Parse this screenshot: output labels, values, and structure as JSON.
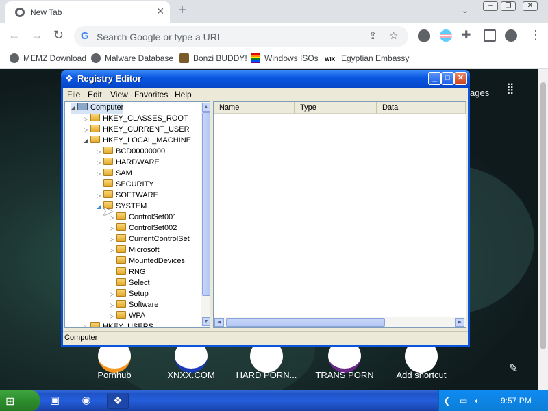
{
  "browser": {
    "tab_title": "New Tab",
    "omnibox_placeholder": "Search Google or type a URL",
    "bookmarks": [
      "MEMZ Download",
      "Malware Database",
      "Bonzi BUDDY!",
      "Windows ISOs",
      "Egyptian Embassy"
    ],
    "images_link": "ages",
    "shortcuts": [
      "Pornhub",
      "XNXX.COM",
      "HARD PORN...",
      "TRANS PORN",
      "Add shortcut"
    ],
    "icons": {
      "back": "back-arrow-icon",
      "forward": "forward-arrow-icon",
      "reload": "reload-icon",
      "share": "share-icon",
      "star": "bookmark-star-icon",
      "extensions": "puzzle-icon",
      "sidepanel": "side-panel-icon",
      "profile": "profile-icon",
      "menu": "kebab-menu-icon",
      "apps": "apps-grid-icon",
      "edit": "pencil-icon"
    }
  },
  "regedit": {
    "title": "Registry Editor",
    "menu": [
      "File",
      "Edit",
      "View",
      "Favorites",
      "Help"
    ],
    "tree": {
      "root": "Computer",
      "hives": [
        "HKEY_CLASSES_ROOT",
        "HKEY_CURRENT_USER",
        "HKEY_LOCAL_MACHINE"
      ],
      "hklm_children": [
        "BCD00000000",
        "HARDWARE",
        "SAM",
        "SECURITY",
        "SOFTWARE",
        "SYSTEM"
      ],
      "system_children": [
        "ControlSet001",
        "ControlSet002",
        "CurrentControlSet",
        "Microsoft",
        "MountedDevices",
        "RNG",
        "Select",
        "Setup",
        "Software",
        "WPA"
      ],
      "last_partial": "HKEY_USERS"
    },
    "columns": [
      "Name",
      "Type",
      "Data"
    ],
    "status": "Computer"
  },
  "taskbar": {
    "clock": "9:57 PM",
    "start_icon": "windows-flag-icon",
    "colors": {
      "taskbar": "#245edb",
      "start": "#2d8e2d",
      "tray": "#0c7ed8"
    }
  }
}
